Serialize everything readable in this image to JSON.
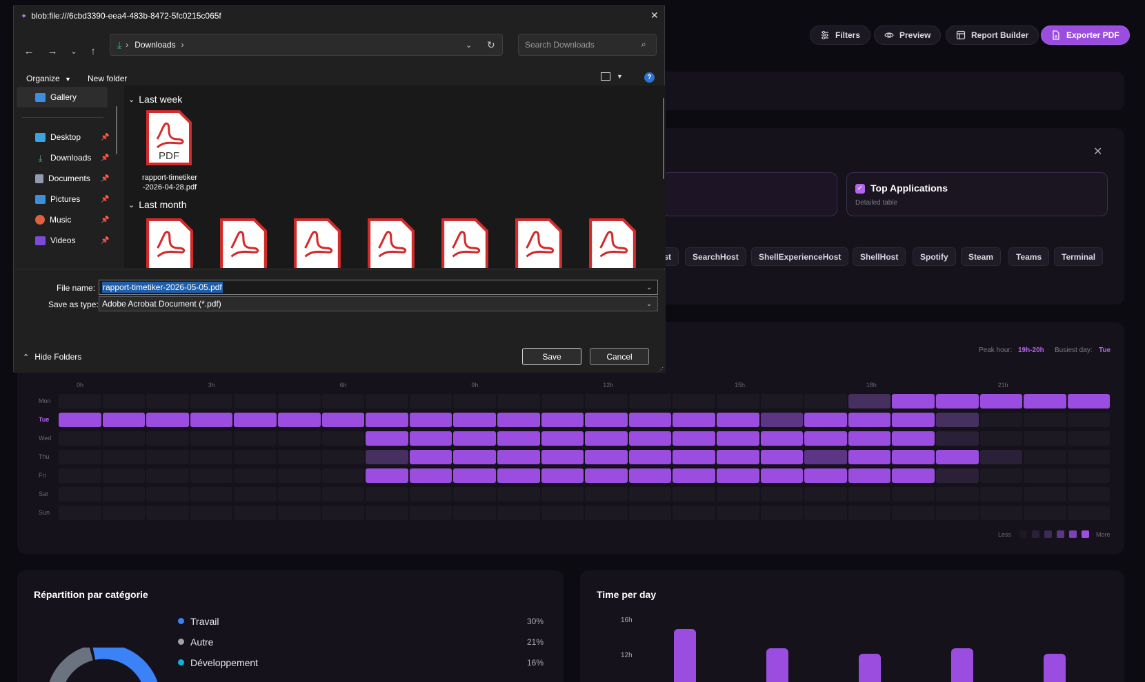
{
  "toolbar": {
    "filters": "Filters",
    "preview": "Preview",
    "report_builder": "Report Builder",
    "export_pdf": "Exporter PDF"
  },
  "selection": {
    "option_title": "Top Applications",
    "option_subtitle": "Detailed table"
  },
  "apps": [
    "st",
    "SearchHost",
    "ShellExperienceHost",
    "ShellHost",
    "Spotify",
    "Steam",
    "Teams",
    "Terminal"
  ],
  "heatmap": {
    "peak_label": "Peak hour:",
    "peak_value": "19h-20h",
    "busiest_label": "Busiest day:",
    "busiest_value": "Tue",
    "hours": [
      "0h",
      "3h",
      "6h",
      "9h",
      "12h",
      "15h",
      "18h",
      "21h"
    ],
    "days": [
      "Mon",
      "Tue",
      "Wed",
      "Thu",
      "Fri",
      "Sat",
      "Sun"
    ],
    "levels": [
      [
        0,
        0,
        0,
        0,
        0,
        0,
        0,
        0,
        0,
        0,
        0,
        0,
        0,
        0,
        0,
        0,
        0,
        0,
        2,
        4,
        4,
        4,
        4,
        4
      ],
      [
        4,
        4,
        4,
        4,
        4,
        4,
        4,
        4,
        4,
        4,
        4,
        4,
        4,
        4,
        4,
        4,
        3,
        4,
        4,
        4,
        2,
        0,
        0,
        0
      ],
      [
        0,
        0,
        0,
        0,
        0,
        0,
        0,
        4,
        4,
        4,
        4,
        4,
        4,
        4,
        4,
        4,
        4,
        4,
        4,
        4,
        1,
        0,
        0,
        0
      ],
      [
        0,
        0,
        0,
        0,
        0,
        0,
        0,
        2,
        4,
        4,
        4,
        4,
        4,
        4,
        4,
        4,
        4,
        3,
        4,
        4,
        4,
        1,
        0,
        0
      ],
      [
        0,
        0,
        0,
        0,
        0,
        0,
        0,
        4,
        4,
        4,
        4,
        4,
        4,
        4,
        4,
        4,
        4,
        4,
        4,
        4,
        1,
        0,
        0,
        0
      ],
      [
        0,
        0,
        0,
        0,
        0,
        0,
        0,
        0,
        0,
        0,
        0,
        0,
        0,
        0,
        0,
        0,
        0,
        0,
        0,
        0,
        0,
        0,
        0,
        0
      ],
      [
        0,
        0,
        0,
        0,
        0,
        0,
        0,
        0,
        0,
        0,
        0,
        0,
        0,
        0,
        0,
        0,
        0,
        0,
        0,
        0,
        0,
        0,
        0,
        0
      ]
    ],
    "legend_less": "Less",
    "legend_more": "More"
  },
  "category": {
    "title": "Répartition par catégorie",
    "items": [
      {
        "label": "Travail",
        "pct": "30%",
        "color": "#3b82f6"
      },
      {
        "label": "Autre",
        "pct": "21%",
        "color": "#9ca3af"
      },
      {
        "label": "Développement",
        "pct": "16%",
        "color": "#06b6d4"
      }
    ]
  },
  "timeperday": {
    "title": "Time per day",
    "ticks": [
      "16h",
      "12h"
    ],
    "values": [
      14.4,
      11,
      10,
      11,
      10
    ]
  },
  "dialog": {
    "title": "blob:file:///6cbd3390-eea4-483b-8472-5fc0215c065f",
    "path": "Downloads",
    "search_placeholder": "Search Downloads",
    "organize": "Organize",
    "new_folder": "New folder",
    "sidebar": {
      "gallery": "Gallery",
      "desktop": "Desktop",
      "downloads": "Downloads",
      "documents": "Documents",
      "pictures": "Pictures",
      "music": "Music",
      "videos": "Videos"
    },
    "groups": {
      "last_week": "Last week",
      "last_month": "Last month"
    },
    "pdf_label": "PDF",
    "file1_name": "rapport-timetiker-2026-04-28.pdf",
    "file1_line1": "rapport-timetiker",
    "file1_line2": "-2026-04-28.pdf",
    "file_name_label": "File name:",
    "file_name_value": "rapport-timetiker-2026-05-05.pdf",
    "save_type_label": "Save as type:",
    "save_type_value": "Adobe Acrobat Document (*.pdf)",
    "hide_folders": "Hide Folders",
    "save": "Save",
    "cancel": "Cancel"
  }
}
